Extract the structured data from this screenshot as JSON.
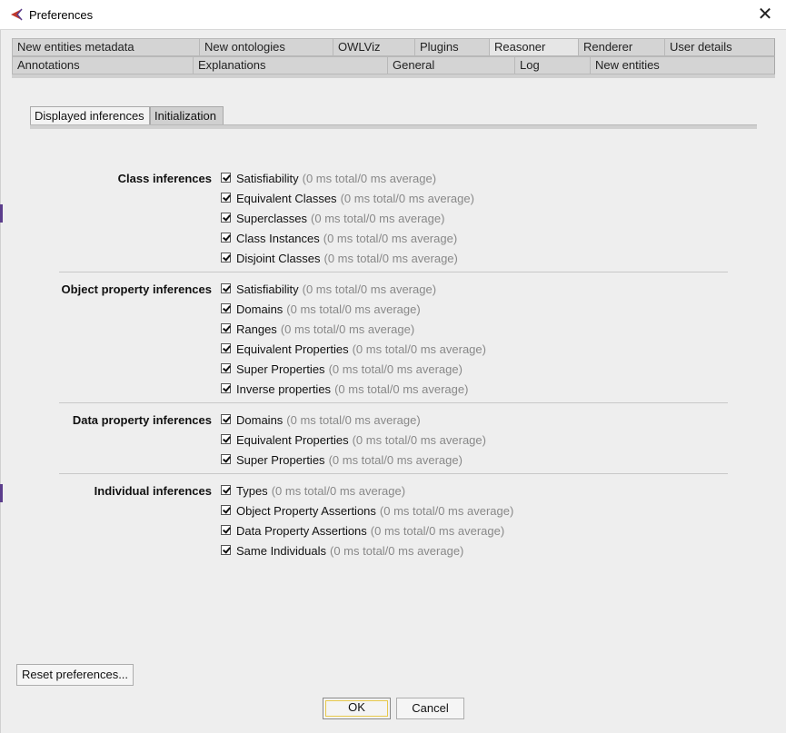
{
  "window": {
    "title": "Preferences",
    "close_glyph": "✕",
    "icon": "protege-logo-icon"
  },
  "tabs": {
    "row1": [
      {
        "label": "New entities metadata"
      },
      {
        "label": "New ontologies"
      },
      {
        "label": "OWLViz"
      },
      {
        "label": "Plugins"
      },
      {
        "label": "Reasoner",
        "selected": true
      },
      {
        "label": "Renderer"
      },
      {
        "label": "User details"
      }
    ],
    "row2": [
      {
        "label": "Annotations"
      },
      {
        "label": "Explanations"
      },
      {
        "label": "General"
      },
      {
        "label": "Log"
      },
      {
        "label": "New entities"
      }
    ]
  },
  "subtabs": [
    {
      "label": "Displayed inferences",
      "active": true
    },
    {
      "label": "Initialization",
      "active": false
    }
  ],
  "sections": [
    {
      "label": "Class inferences",
      "items": [
        {
          "label": "Satisfiability",
          "stats": "(0 ms total/0 ms average)",
          "checked": true
        },
        {
          "label": "Equivalent Classes",
          "stats": "(0 ms total/0 ms average)",
          "checked": true
        },
        {
          "label": "Superclasses",
          "stats": "(0 ms total/0 ms average)",
          "checked": true
        },
        {
          "label": "Class Instances",
          "stats": "(0 ms total/0 ms average)",
          "checked": true
        },
        {
          "label": "Disjoint Classes",
          "stats": "(0 ms total/0 ms average)",
          "checked": true
        }
      ]
    },
    {
      "label": "Object property inferences",
      "items": [
        {
          "label": "Satisfiability",
          "stats": "(0 ms total/0 ms average)",
          "checked": true
        },
        {
          "label": "Domains",
          "stats": "(0 ms total/0 ms average)",
          "checked": true
        },
        {
          "label": "Ranges",
          "stats": "(0 ms total/0 ms average)",
          "checked": true
        },
        {
          "label": "Equivalent Properties",
          "stats": "(0 ms total/0 ms average)",
          "checked": true
        },
        {
          "label": "Super Properties",
          "stats": "(0 ms total/0 ms average)",
          "checked": true
        },
        {
          "label": "Inverse properties",
          "stats": "(0 ms total/0 ms average)",
          "checked": true
        }
      ]
    },
    {
      "label": "Data property inferences",
      "items": [
        {
          "label": "Domains",
          "stats": "(0 ms total/0 ms average)",
          "checked": true
        },
        {
          "label": "Equivalent Properties",
          "stats": "(0 ms total/0 ms average)",
          "checked": true
        },
        {
          "label": "Super Properties",
          "stats": "(0 ms total/0 ms average)",
          "checked": true
        }
      ]
    },
    {
      "label": "Individual inferences",
      "items": [
        {
          "label": "Types",
          "stats": "(0 ms total/0 ms average)",
          "checked": true
        },
        {
          "label": "Object Property Assertions",
          "stats": "(0 ms total/0 ms average)",
          "checked": true
        },
        {
          "label": "Data Property Assertions",
          "stats": "(0 ms total/0 ms average)",
          "checked": true
        },
        {
          "label": "Same Individuals",
          "stats": "(0 ms total/0 ms average)",
          "checked": true
        }
      ]
    }
  ],
  "buttons": {
    "reset": "Reset preferences...",
    "ok": "OK",
    "cancel": "Cancel"
  },
  "colors": {
    "focus_ring": "#e7c84a",
    "stats_text": "#888888"
  }
}
